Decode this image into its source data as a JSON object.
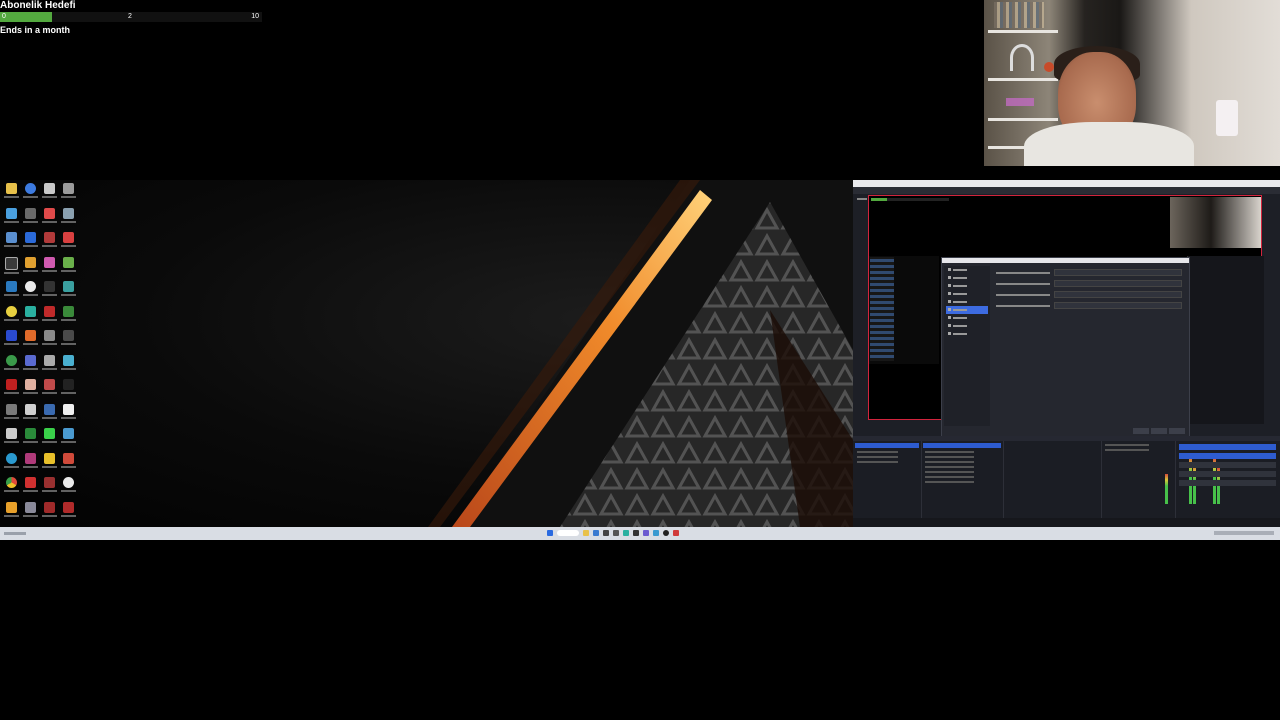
{
  "goal": {
    "title": "Abonelik Hedefi",
    "start": "0",
    "mid": "2",
    "end": "10",
    "progress_fraction": 0.2,
    "footer": "Ends in a month",
    "fill_color": "#53a93f"
  },
  "icons": {
    "folder": "folder-icon",
    "windows": "windows-start-icon",
    "search": "search-icon"
  }
}
